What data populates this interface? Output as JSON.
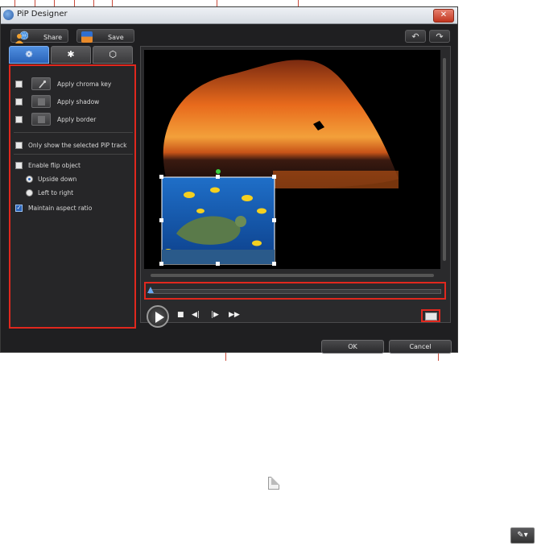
{
  "window": {
    "title": "PiP Designer",
    "close_glyph": "✕"
  },
  "toolbar": {
    "share_label": "Share",
    "save_label": "Save",
    "undo_glyph": "↶",
    "redo_glyph": "↷"
  },
  "tabs": [
    {
      "name": "properties",
      "icon": "snowflake-settings-icon",
      "glyph": "❁",
      "active": true
    },
    {
      "name": "motion",
      "icon": "motion-path-icon",
      "glyph": "✱",
      "active": false
    },
    {
      "name": "mask",
      "icon": "mask-icon",
      "glyph": "⬡",
      "active": false
    }
  ],
  "options": {
    "chroma_key": "Apply chroma key",
    "shadow": "Apply shadow",
    "border": "Apply border",
    "only_selected": "Only show the selected PiP track",
    "enable_flip": "Enable flip object",
    "upside_down": "Upside down",
    "left_to_right": "Left to right",
    "maintain_aspect": "Maintain aspect ratio",
    "maintain_checked_glyph": "✓"
  },
  "playback": {
    "stop_glyph": "■",
    "prev_frame_glyph": "◀|",
    "next_frame_glyph": "|▶",
    "fast_forward_glyph": "▶▶"
  },
  "buttons": {
    "ok_label": "OK",
    "cancel_label": "Cancel"
  },
  "colors": {
    "highlight": "#e0281e",
    "accent": "#2a63b8"
  }
}
